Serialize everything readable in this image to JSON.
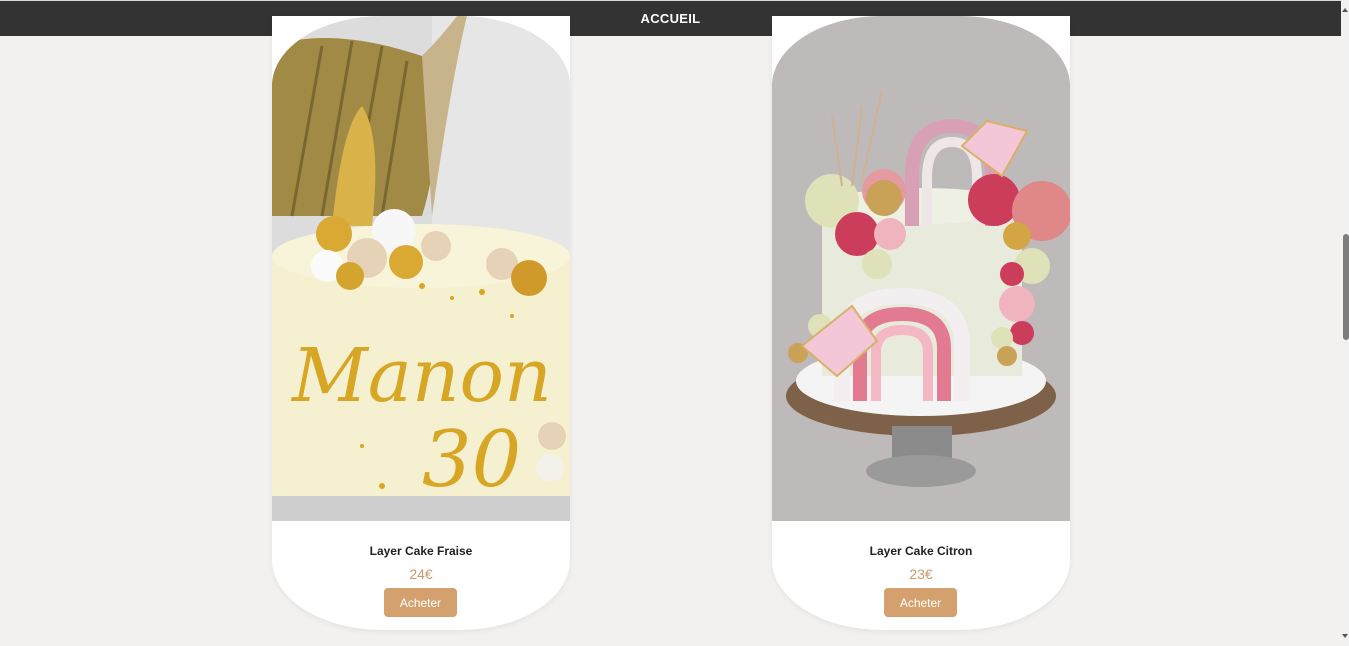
{
  "nav": {
    "home_label": "ACCUEIL"
  },
  "products": [
    {
      "name": "Layer Cake Fraise",
      "price": "24€",
      "button_label": "Acheter",
      "cake_text_line1": "Manon",
      "cake_text_line2": "30"
    },
    {
      "name": "Layer Cake Citron",
      "price": "23€",
      "button_label": "Acheter"
    }
  ],
  "colors": {
    "header_bg": "#333333",
    "page_bg": "#f2f1ef",
    "price": "#c99a6b",
    "button_bg": "#d4a06e"
  }
}
